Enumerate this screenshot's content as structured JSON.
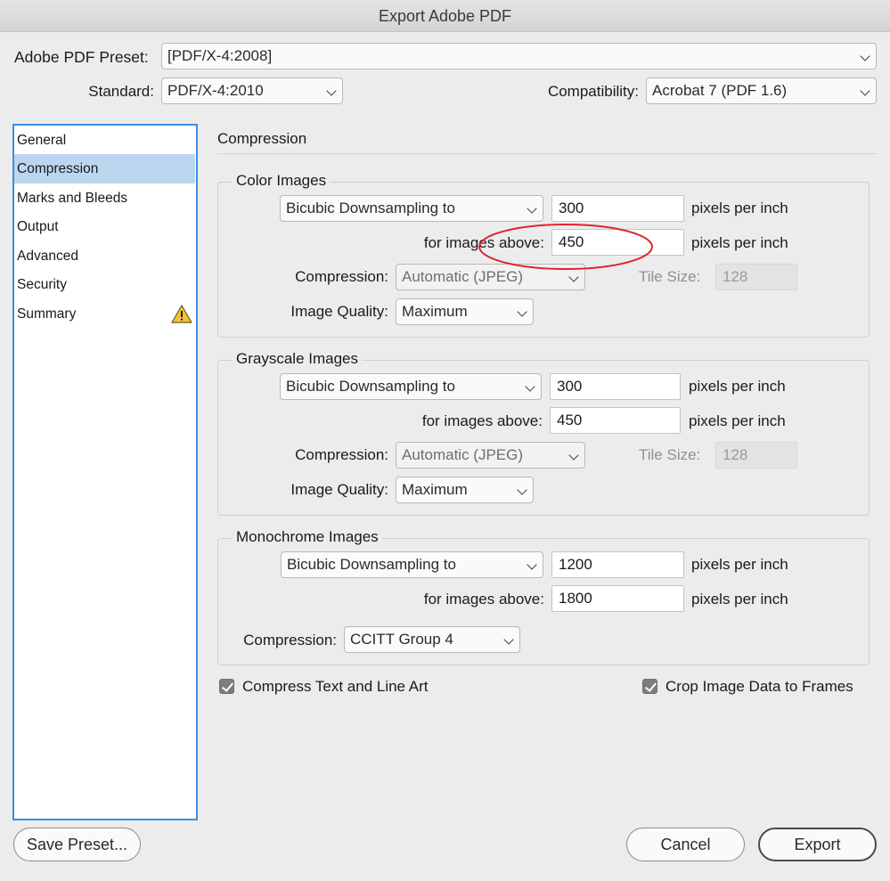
{
  "window": {
    "title": "Export Adobe PDF"
  },
  "preset": {
    "label": "Adobe PDF Preset:",
    "value": "[PDF/X-4:2008]"
  },
  "standard": {
    "label": "Standard:",
    "value": "PDF/X-4:2010"
  },
  "compatibility": {
    "label": "Compatibility:",
    "value": "Acrobat 7 (PDF 1.6)"
  },
  "sidebar": {
    "items": [
      {
        "label": "General"
      },
      {
        "label": "Compression",
        "selected": true
      },
      {
        "label": "Marks and Bleeds"
      },
      {
        "label": "Output"
      },
      {
        "label": "Advanced"
      },
      {
        "label": "Security"
      },
      {
        "label": "Summary",
        "icon": "warning-icon"
      }
    ]
  },
  "section": {
    "title": "Compression"
  },
  "color_images": {
    "legend": "Color Images",
    "downsampling": "Bicubic Downsampling to",
    "ppi": "300",
    "ppi_unit": "pixels per inch",
    "above_label": "for images above:",
    "above": "450",
    "above_unit": "pixels per inch",
    "compression_label": "Compression:",
    "compression": "Automatic (JPEG)",
    "tile_label": "Tile Size:",
    "tile": "128",
    "quality_label": "Image Quality:",
    "quality": "Maximum"
  },
  "grayscale_images": {
    "legend": "Grayscale Images",
    "downsampling": "Bicubic Downsampling to",
    "ppi": "300",
    "ppi_unit": "pixels per inch",
    "above_label": "for images above:",
    "above": "450",
    "above_unit": "pixels per inch",
    "compression_label": "Compression:",
    "compression": "Automatic (JPEG)",
    "tile_label": "Tile Size:",
    "tile": "128",
    "quality_label": "Image Quality:",
    "quality": "Maximum"
  },
  "monochrome_images": {
    "legend": "Monochrome Images",
    "downsampling": "Bicubic Downsampling to",
    "ppi": "1200",
    "ppi_unit": "pixels per inch",
    "above_label": "for images above:",
    "above": "1800",
    "above_unit": "pixels per inch",
    "compression_label": "Compression:",
    "compression": "CCITT Group 4"
  },
  "options": {
    "compress_text": {
      "label": "Compress Text and Line Art",
      "checked": true
    },
    "crop_image": {
      "label": "Crop Image Data to Frames",
      "checked": true
    }
  },
  "buttons": {
    "save_preset": "Save Preset...",
    "cancel": "Cancel",
    "export": "Export"
  },
  "colors": {
    "sidebar_border": "#3b8ee0",
    "sidebar_selected": "#bcd6f0",
    "annotation": "#e0232a",
    "warning": "#f4c430"
  }
}
